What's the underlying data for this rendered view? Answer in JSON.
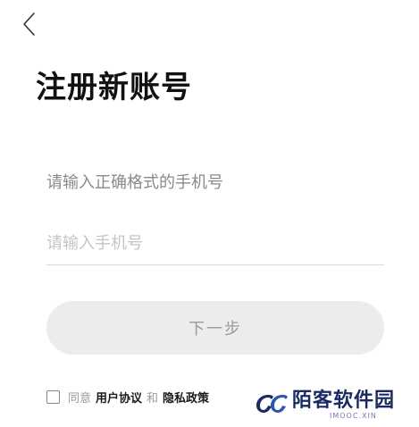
{
  "header": {
    "back_icon": "chevron-left-icon",
    "title": "注册新账号"
  },
  "form": {
    "hint": "请输入正确格式的手机号",
    "phone_placeholder": "请输入手机号",
    "phone_value": "",
    "next_label": "下一步"
  },
  "agreement": {
    "checked": false,
    "prefix": "同意",
    "user_agreement": "用户协议",
    "connector": "和",
    "privacy_policy": "隐私政策"
  },
  "watermark": {
    "name": "陌客软件园",
    "sub": "IMOOC.XIN"
  },
  "colors": {
    "button_bg": "#ececec",
    "button_text": "#9c9c9c",
    "hint_text": "#8a8a8a",
    "watermark_blue": "#1b2a63"
  }
}
